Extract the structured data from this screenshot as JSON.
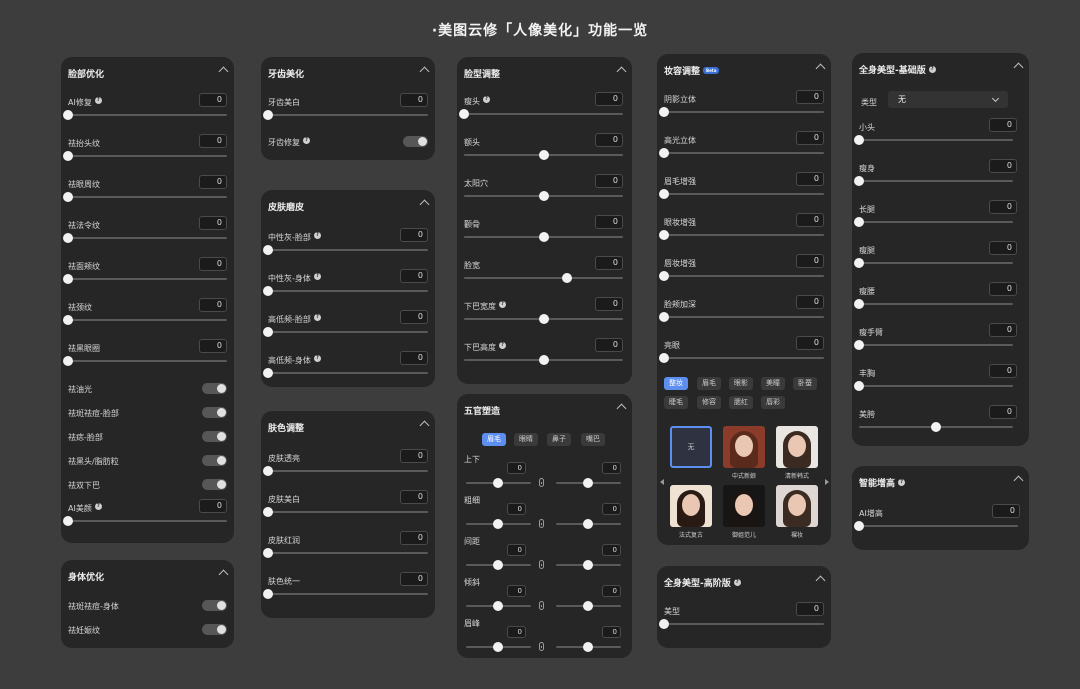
{
  "page_title": "·美图云修「人像美化」功能一览",
  "face_opt": {
    "title": "脸部优化",
    "sliders": [
      {
        "label": "AI修复",
        "value": "0",
        "info": true
      },
      {
        "label": "祛抬头纹",
        "value": "0"
      },
      {
        "label": "祛眼周纹",
        "value": "0"
      },
      {
        "label": "祛法令纹",
        "value": "0"
      },
      {
        "label": "祛面颊纹",
        "value": "0"
      },
      {
        "label": "祛颈纹",
        "value": "0"
      },
      {
        "label": "祛黑眼圈",
        "value": "0"
      }
    ],
    "toggles": [
      "祛油光",
      "祛斑祛痘-脸部",
      "祛痣-脸部",
      "祛黑头/脂肪粒",
      "祛双下巴"
    ],
    "ai_beauty": {
      "label": "AI美颜",
      "value": "0"
    }
  },
  "body_opt": {
    "title": "身体优化",
    "toggles": [
      "祛斑祛痘-身体",
      "祛妊娠纹"
    ]
  },
  "teeth": {
    "title": "牙齿美化",
    "slider": {
      "label": "牙齿美白",
      "value": "0"
    },
    "toggle": "牙齿修复"
  },
  "skin_smooth": {
    "title": "皮肤磨皮",
    "sliders": [
      {
        "label": "中性灰-脸部",
        "value": "0"
      },
      {
        "label": "中性灰-身体",
        "value": "0"
      },
      {
        "label": "高低频-脸部",
        "value": "0"
      },
      {
        "label": "高低频-身体",
        "value": "0"
      }
    ]
  },
  "skin_tone": {
    "title": "肤色调整",
    "sliders": [
      {
        "label": "皮肤透亮",
        "value": "0"
      },
      {
        "label": "皮肤美白",
        "value": "0"
      },
      {
        "label": "皮肤红润",
        "value": "0"
      },
      {
        "label": "肤色统一",
        "value": "0"
      }
    ]
  },
  "face_shape": {
    "title": "脸型调整",
    "sliders": [
      {
        "label": "瘦头",
        "value": "0",
        "info": true,
        "level": 0
      },
      {
        "label": "额头",
        "value": "0",
        "level": 0.5
      },
      {
        "label": "太阳穴",
        "value": "0",
        "level": 0.5
      },
      {
        "label": "颧骨",
        "value": "0",
        "level": 0.5
      },
      {
        "label": "脸宽",
        "value": "0",
        "level": 0.65
      },
      {
        "label": "下巴宽度",
        "value": "0",
        "info": true,
        "level": 0.5
      },
      {
        "label": "下巴高度",
        "value": "0",
        "info": true,
        "level": 0.5
      }
    ]
  },
  "features": {
    "title": "五官塑造",
    "tabs": [
      "眉毛",
      "眼睛",
      "鼻子",
      "嘴巴"
    ],
    "rows": [
      {
        "label": "上下",
        "left": "0",
        "right": "0"
      },
      {
        "label": "粗细",
        "left": "0",
        "right": "0"
      },
      {
        "label": "间距",
        "left": "0",
        "right": "0"
      },
      {
        "label": "倾斜",
        "left": "0",
        "right": "0"
      },
      {
        "label": "眉峰",
        "left": "0",
        "right": "0"
      }
    ]
  },
  "makeup": {
    "title": "妆容调整",
    "badge": "Beta",
    "sliders": [
      {
        "label": "阴影立体",
        "value": "0"
      },
      {
        "label": "高光立体",
        "value": "0"
      },
      {
        "label": "眉毛增强",
        "value": "0"
      },
      {
        "label": "眼妆增强",
        "value": "0"
      },
      {
        "label": "唇妆增强",
        "value": "0"
      },
      {
        "label": "脸颊加深",
        "value": "0"
      },
      {
        "label": "亮眼",
        "value": "0"
      }
    ],
    "tabs": [
      "整妆",
      "眉毛",
      "眼影",
      "美瞳",
      "卧蚕",
      "睫毛",
      "修容",
      "腮红",
      "唇彩"
    ],
    "styles": [
      "无",
      "中式新娘",
      "清新韩式",
      "法式复古",
      "御姐范儿",
      "裸妆"
    ]
  },
  "body_pro": {
    "title": "全身美型-高阶版",
    "slider": {
      "label": "美型",
      "value": "0"
    }
  },
  "body_basic": {
    "title": "全身美型-基础版",
    "type_label": "类型",
    "type_value": "无",
    "sliders": [
      {
        "label": "小头",
        "value": "0",
        "level": 0
      },
      {
        "label": "瘦身",
        "value": "0",
        "level": 0
      },
      {
        "label": "长腿",
        "value": "0",
        "level": 0
      },
      {
        "label": "瘦腿",
        "value": "0",
        "level": 0
      },
      {
        "label": "瘦腰",
        "value": "0",
        "level": 0
      },
      {
        "label": "瘦手臂",
        "value": "0",
        "level": 0
      },
      {
        "label": "丰胸",
        "value": "0",
        "level": 0
      },
      {
        "label": "美胯",
        "value": "0",
        "level": 0.5
      }
    ]
  },
  "height": {
    "title": "智能增高",
    "slider": {
      "label": "AI增高",
      "value": "0"
    }
  }
}
